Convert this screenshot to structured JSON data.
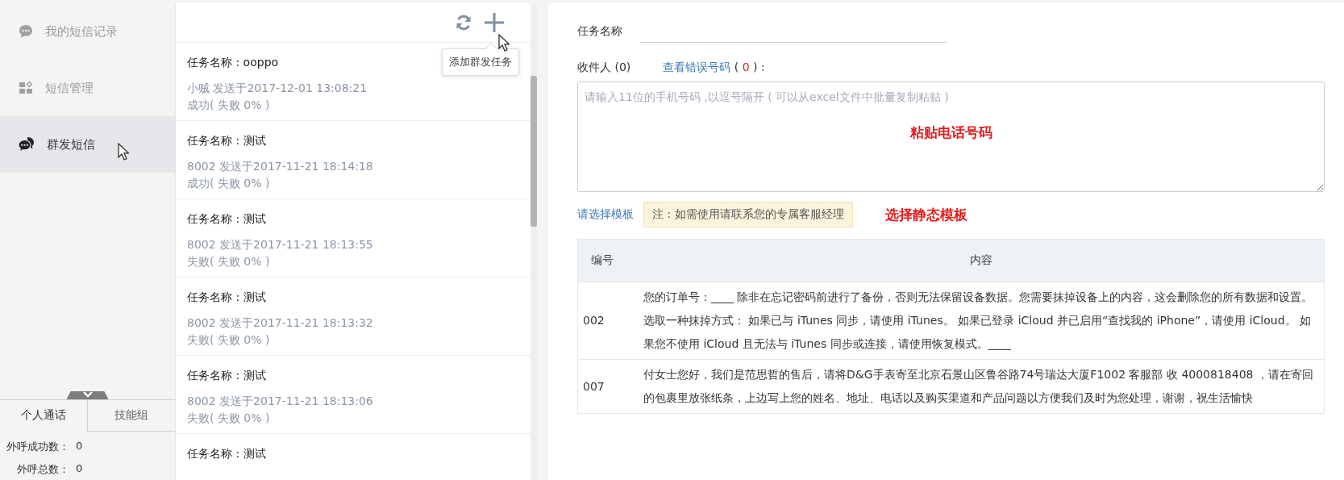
{
  "sidebar": {
    "items": [
      {
        "label": "我的短信记录",
        "selected": false
      },
      {
        "label": "短信管理",
        "selected": false
      },
      {
        "label": "群发短信",
        "selected": true
      }
    ],
    "tabs": [
      {
        "label": "个人通话",
        "selected": true
      },
      {
        "label": "技能组",
        "selected": false
      }
    ],
    "stats": [
      {
        "label": "外呼成功数：",
        "value": "0"
      },
      {
        "label": "外呼总数：",
        "value": "0"
      }
    ]
  },
  "task_list": {
    "tooltip": "添加群发任务",
    "tasks": [
      {
        "title": "任务名称 : ooppo",
        "sent": "小贼 发送于2017-12-01 13:08:21",
        "result": "成功( 失败 0% )"
      },
      {
        "title": "任务名称 : 测试",
        "sent": "8002 发送于2017-11-21 18:14:18",
        "result": "成功( 失败 0% )"
      },
      {
        "title": "任务名称 : 测试",
        "sent": "8002 发送于2017-11-21 18:13:55",
        "result": "失败( 失败 0% )"
      },
      {
        "title": "任务名称 : 测试",
        "sent": "8002 发送于2017-11-21 18:13:32",
        "result": "失败( 失败 0% )"
      },
      {
        "title": "任务名称 : 测试",
        "sent": "8002 发送于2017-11-21 18:13:06",
        "result": "失败( 失败 0% )"
      },
      {
        "title": "任务名称 : 测试"
      }
    ]
  },
  "form": {
    "task_name_label": "任务名称",
    "recipients_label": "收件人 (0)",
    "error_link": "查看错误号码",
    "error_open": "(",
    "error_count": "0",
    "error_close": ") :",
    "recipients_placeholder": "请输入11位的手机号码 ,以逗号隔开 ( 可以从excel文件中批量复制粘贴 )",
    "recipients_annotation": "粘贴电话号码",
    "template_link": "请选择模板",
    "template_note": "注 : 如需使用请联系您的专属客服经理",
    "template_annotation": "选择静态模板"
  },
  "table": {
    "columns": [
      "编号",
      "内容"
    ],
    "rows": [
      [
        "002",
        "您的订单号：____ 除非在忘记密码前进行了备份，否则无法保留设备数据。您需要抹掉设备上的内容，这会删除您的所有数据和设置。选取一种抹掉方式： 如果已与 iTunes 同步，请使用 iTunes。 如果已登录 iCloud 并已启用“查找我的 iPhone”，请使用 iCloud。 如果您不使用 iCloud 且无法与 iTunes 同步或连接，请使用恢复模式。____"
      ],
      [
        "007",
        "付女士您好，我们是范思哲的售后，请将D&G手表寄至北京石景山区鲁谷路74号瑞达大厦F1002 客服部 收 4000818408 ，请在寄回的包裹里放张纸条，上边写上您的姓名、地址、电话以及购买渠道和产品问题以方便我们及时为您处理，谢谢，祝生活愉快"
      ]
    ]
  }
}
